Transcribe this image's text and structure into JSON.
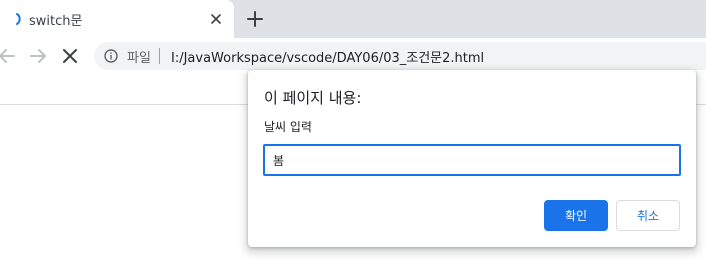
{
  "browser": {
    "tab": {
      "title": "switch문"
    },
    "omnibox": {
      "security_chip": "파일",
      "url": "I:/JavaWorkspace/vscode/DAY06/03_조건문2.html"
    },
    "icons": {
      "favicon": "loading-spinner-icon",
      "tab_close": "close-icon",
      "new_tab": "plus-icon",
      "back": "arrow-left-icon",
      "forward": "arrow-right-icon",
      "stop": "close-icon",
      "info": "info-icon"
    },
    "colors": {
      "tabstrip": "#dee1e6",
      "omnibox": "#f1f3f4",
      "accent": "#1a73e8"
    }
  },
  "dialog": {
    "title": "이 페이지 내용:",
    "message": "날씨 입력",
    "input_value": "봄",
    "ok_label": "확인",
    "cancel_label": "취소"
  }
}
